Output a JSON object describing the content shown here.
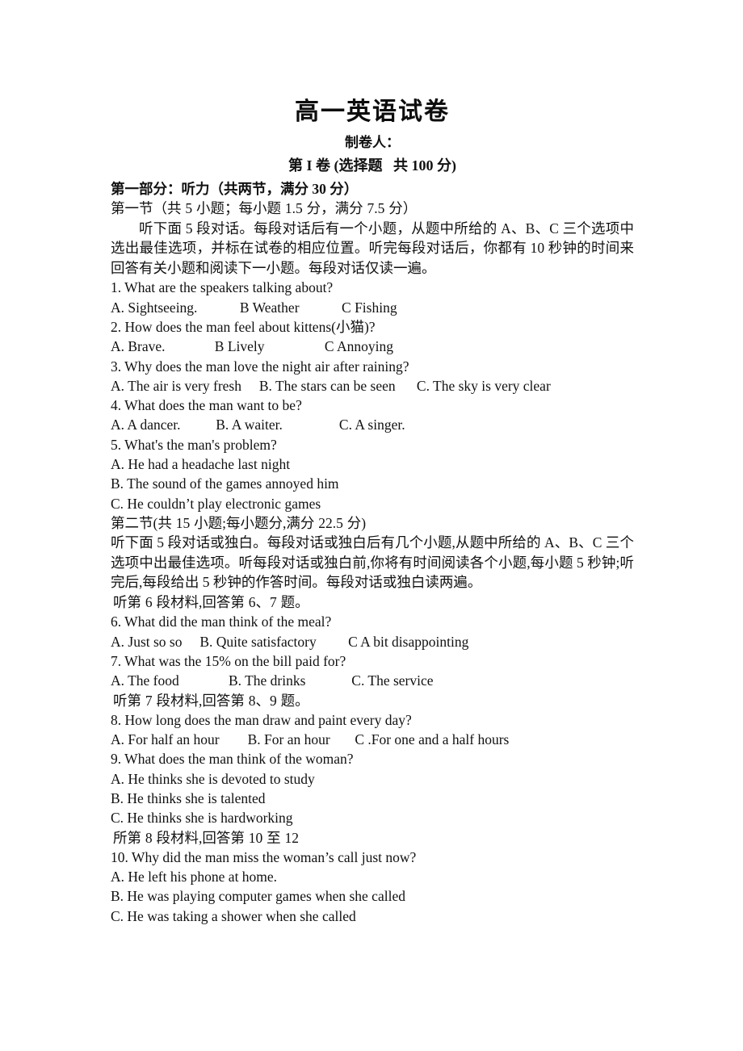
{
  "document": {
    "title": "高一英语试卷",
    "maker_line": "制卷人：",
    "paper_part_line": "第 I 卷 (选择题   共 100 分)"
  },
  "part_one": {
    "heading": "第一部分：听力（共两节，满分 30 分）",
    "section_one_heading": "第一节（共 5 小题；每小题 1.5 分，满分 7.5 分）",
    "section_one_instructions": "听下面 5 段对话。每段对话后有一个小题，从题中所给的 A、B、C 三个选项中选出最佳选项，并标在试卷的相应位置。听完每段对话后，你都有 10 秒钟的时间来回答有关小题和阅读下一小题。每段对话仅读一遍。",
    "section_two_heading": "第二节(共 15 小题;每小题分,满分 22.5 分)",
    "section_two_instructions": "听下面 5 段对话或独白。每段对话或独白后有几个小题,从题中所给的 A、B、C 三个选项中出最佳选项。听每段对话或独白前,你将有时间阅读各个小题,每小题 5 秒钟;听完后,每段给出 5 秒钟的作答时间。每段对话或独白读两遍。"
  },
  "material_notes": {
    "note_6_7": "听第 6 段材料,回答第 6、7 题。",
    "note_8_9": "听第 7 段材料,回答第 8、9 题。",
    "note_10_12": "所第 8 段材料,回答第 10 至 12"
  },
  "questions": [
    {
      "number": "1.",
      "stem": "1. What are the speakers talking about?",
      "options_line": "A. Sightseeing.            B Weather            C Fishing",
      "options": [
        "A. Sightseeing.",
        "B Weather",
        "C Fishing"
      ],
      "layout": "inline"
    },
    {
      "number": "2.",
      "stem": "2. How does the man feel about kittens(小猫)?",
      "options_line": "A. Brave.              B Lively                 C Annoying",
      "options": [
        "A. Brave.",
        "B Lively",
        "C Annoying"
      ],
      "layout": "inline"
    },
    {
      "number": "3.",
      "stem": "3. Why does the man love the night air after raining?",
      "options_line": "A. The air is very fresh     B. The stars can be seen      C. The sky is very clear",
      "options": [
        "A. The air is very fresh",
        "B. The stars can be seen",
        "C. The sky is very clear"
      ],
      "layout": "inline"
    },
    {
      "number": "4.",
      "stem": "4. What does the man want to be?",
      "options_line": "A. A dancer.          B. A waiter.                C. A singer.",
      "options": [
        "A. A dancer.",
        "B. A waiter.",
        "C. A singer."
      ],
      "layout": "inline"
    },
    {
      "number": "5.",
      "stem": "5. What's the man's problem?",
      "options": [
        "A. He had a headache last night",
        "B. The sound of the games annoyed him",
        "C. He couldn’t play electronic games"
      ],
      "layout": "stacked"
    },
    {
      "number": "6.",
      "stem": "6. What did the man think of the meal?",
      "options_line": "A. Just so so     B. Quite satisfactory         C A bit disappointing",
      "options": [
        "A. Just so so",
        "B. Quite satisfactory",
        "C A bit disappointing"
      ],
      "layout": "inline"
    },
    {
      "number": "7.",
      "stem": "7. What was the 15% on the bill paid for?",
      "options_line": "A. The food              B. The drinks             C. The service",
      "options": [
        "A. The food",
        "B. The drinks",
        "C. The service"
      ],
      "layout": "inline"
    },
    {
      "number": "8.",
      "stem": "8. How long does the man draw and paint every day?",
      "options_line": "A. For half an hour        B. For an hour       C .For one and a half hours",
      "options": [
        "A. For half an hour",
        "B. For an hour",
        "C .For one and a half hours"
      ],
      "layout": "inline"
    },
    {
      "number": "9.",
      "stem": "9. What does the man think of the woman?",
      "options": [
        "A. He thinks she is devoted to study",
        "B. He thinks she is talented",
        "C. He thinks she is hardworking"
      ],
      "layout": "stacked"
    },
    {
      "number": "10.",
      "stem": "10. Why did the man miss the woman’s call just now?",
      "options": [
        "A. He left his phone at home.",
        "B. He was playing computer games when she called",
        "C. He was taking a shower when she called"
      ],
      "layout": "stacked"
    }
  ]
}
